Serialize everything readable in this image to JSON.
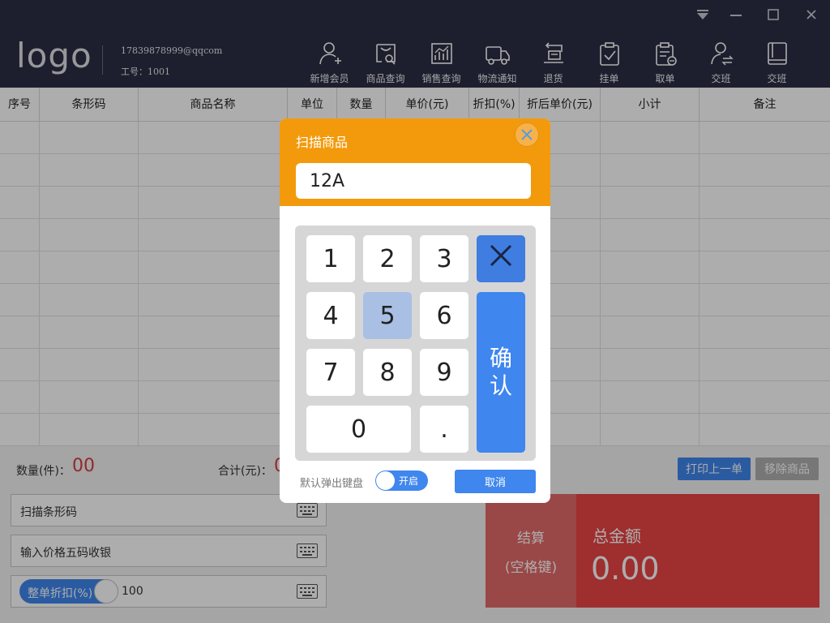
{
  "window": {
    "controls": [
      "dropdown-icon",
      "minimize-icon",
      "maximize-icon",
      "close-icon"
    ]
  },
  "header": {
    "logo": "logo",
    "user_email": "17839878999@qqcom",
    "user_id": "工号：1001"
  },
  "toolbar": {
    "items": [
      {
        "label": "新增会员",
        "icon": "add-user-icon"
      },
      {
        "label": "商品查询",
        "icon": "product-search-icon"
      },
      {
        "label": "销售查询",
        "icon": "sales-chart-icon"
      },
      {
        "label": "物流通知",
        "icon": "truck-icon"
      },
      {
        "label": "退货",
        "icon": "return-icon"
      },
      {
        "label": "挂单",
        "icon": "clipboard-check-icon"
      },
      {
        "label": "取单",
        "icon": "clipboard-take-icon"
      },
      {
        "label": "交班",
        "icon": "user-swap-icon"
      },
      {
        "label": "交班",
        "icon": "book-icon"
      }
    ]
  },
  "table": {
    "columns": [
      "序号",
      "条形码",
      "商品名称",
      "单位",
      "数量",
      "单价(元)",
      "折扣(%)",
      "折后单价(元)",
      "小计",
      "备注"
    ]
  },
  "summary": {
    "qty_label": "数量(件)：",
    "qty_value": "00",
    "total_label": "合计(元)：",
    "total_value": "0"
  },
  "inputs": {
    "barcode": "扫描条形码",
    "price_code": "输入价格五码收银",
    "discount_toggle": "整单折扣(%)",
    "discount_value": "100"
  },
  "actions": {
    "print_last": "打印上一单",
    "remove_item": "移除商品"
  },
  "checkout": {
    "label": "结算",
    "shortcut": "(空格键)",
    "total_label": "总金额",
    "total_value": "0.00"
  },
  "modal": {
    "title": "扫描商品",
    "input_value": "12A",
    "keys": [
      "1",
      "2",
      "3",
      "4",
      "5",
      "6",
      "7",
      "8",
      "9",
      "0",
      "."
    ],
    "highlighted_key": "5",
    "confirm": "确\n认",
    "default_keyboard_label": "默认弹出键盘",
    "switch_state": "开启",
    "cancel": "取消"
  },
  "colors": {
    "header_bg": "#2d2f45",
    "accent_blue": "#3f86ee",
    "modal_orange": "#f39a0c",
    "total_red": "#ea4444"
  }
}
